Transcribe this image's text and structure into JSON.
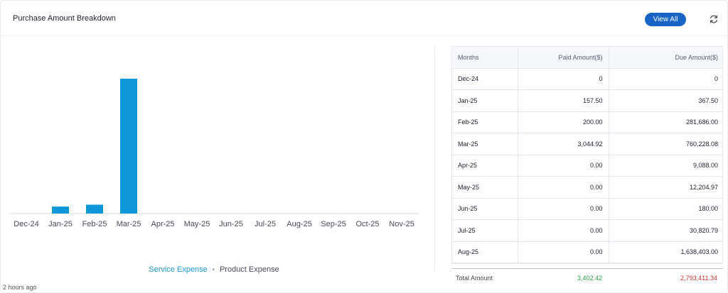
{
  "header": {
    "title": "Purchase Amount Breakdown",
    "view_all_label": "View All",
    "refresh_icon": "refresh-icon"
  },
  "chart_data": {
    "type": "bar",
    "categories": [
      "Dec-24",
      "Jan-25",
      "Feb-25",
      "Mar-25",
      "Apr-25",
      "May-25",
      "Jun-25",
      "Jul-25",
      "Aug-25",
      "Sep-25",
      "Oct-25",
      "Nov-25"
    ],
    "series": [
      {
        "name": "Service Expense",
        "values": [
          0,
          157.5,
          200,
          3044.92,
          0,
          0,
          0,
          0,
          0,
          0,
          0,
          0
        ]
      },
      {
        "name": "Product Expense",
        "values": [
          0,
          0,
          0,
          0,
          0,
          0,
          0,
          0,
          0,
          0,
          0,
          0
        ]
      }
    ],
    "ylim": [
      0,
      3300
    ],
    "grid": false,
    "bar_color": "#0d96d8"
  },
  "legend": {
    "items": [
      {
        "label": "Service Expense",
        "color": "#1e96d6"
      },
      {
        "label": "Product Expense",
        "color": "#4a4a5a"
      }
    ],
    "separator": "•"
  },
  "footer": {
    "updated": "2 hours ago"
  },
  "table": {
    "headers": [
      "Months",
      "Paid Amount($)",
      "Due Amount($)"
    ],
    "rows": [
      [
        "Dec-24",
        "0",
        "0"
      ],
      [
        "Jan-25",
        "157.50",
        "367.50"
      ],
      [
        "Feb-25",
        "200.00",
        "281,686.00"
      ],
      [
        "Mar-25",
        "3,044.92",
        "760,228.08"
      ],
      [
        "Apr-25",
        "0.00",
        "9,088.00"
      ],
      [
        "May-25",
        "0.00",
        "12,204.97"
      ],
      [
        "Jun-25",
        "0.00",
        "180.00"
      ],
      [
        "Jul-25",
        "0.00",
        "30,820.79"
      ],
      [
        "Aug-25",
        "0.00",
        "1,638,403.00"
      ],
      [
        "",
        "",
        ""
      ]
    ],
    "total": {
      "label": "Total Amount",
      "paid": "3,402.42",
      "due": "2,793,411.34"
    },
    "colors": {
      "paid_total": "#27a04a",
      "due_total": "#d2322d"
    }
  }
}
